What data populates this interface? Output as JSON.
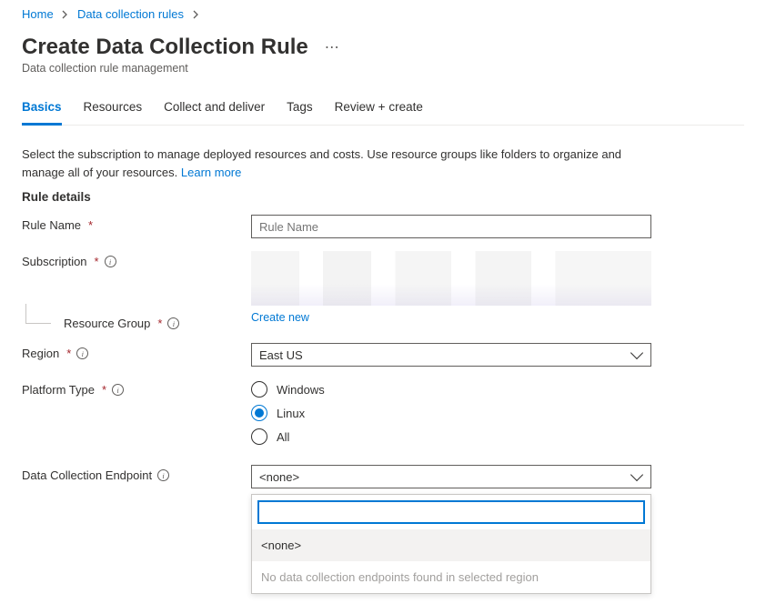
{
  "breadcrumb": {
    "home": "Home",
    "parent": "Data collection rules"
  },
  "header": {
    "title": "Create Data Collection Rule",
    "more": "⋯",
    "subtitle": "Data collection rule management"
  },
  "tabs": [
    {
      "label": "Basics",
      "active": true
    },
    {
      "label": "Resources",
      "active": false
    },
    {
      "label": "Collect and deliver",
      "active": false
    },
    {
      "label": "Tags",
      "active": false
    },
    {
      "label": "Review + create",
      "active": false
    }
  ],
  "description": {
    "text": "Select the subscription to manage deployed resources and costs. Use resource groups like folders to organize and manage all of your resources.",
    "learn_more": "Learn more"
  },
  "section_title": "Rule details",
  "fields": {
    "ruleName": {
      "label": "Rule Name",
      "placeholder": "Rule Name",
      "value": ""
    },
    "subscription": {
      "label": "Subscription"
    },
    "resourceGroup": {
      "label": "Resource Group",
      "create_new": "Create new"
    },
    "region": {
      "label": "Region",
      "value": "East US"
    },
    "platform": {
      "label": "Platform Type",
      "options": [
        {
          "label": "Windows",
          "checked": false
        },
        {
          "label": "Linux",
          "checked": true
        },
        {
          "label": "All",
          "checked": false
        }
      ]
    },
    "dce": {
      "label": "Data Collection Endpoint",
      "value": "<none>",
      "search_value": "",
      "options_none": "<none>",
      "empty_msg": "No data collection endpoints found in selected region"
    }
  }
}
